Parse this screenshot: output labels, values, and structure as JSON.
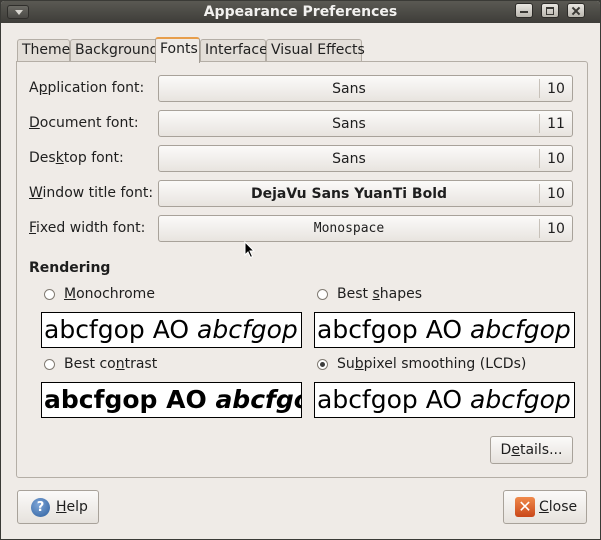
{
  "window": {
    "title": "Appearance Preferences"
  },
  "tabs": [
    {
      "label": "Theme"
    },
    {
      "label": "Background"
    },
    {
      "label": "Fonts"
    },
    {
      "label": "Interface"
    },
    {
      "label": "Visual Effects"
    }
  ],
  "fonts": [
    {
      "pre": "A",
      "key": "p",
      "post": "plication font:",
      "value": "Sans",
      "size": "10"
    },
    {
      "pre": "",
      "key": "D",
      "post": "ocument font:",
      "value": "Sans",
      "size": "11"
    },
    {
      "pre": "Des",
      "key": "k",
      "post": "top font:",
      "value": "Sans",
      "size": "10"
    },
    {
      "pre": "",
      "key": "W",
      "post": "indow title font:",
      "value": "DejaVu Sans YuanTi Bold",
      "size": "10"
    },
    {
      "pre": "",
      "key": "F",
      "post": "ixed width font:",
      "value": "Monospace",
      "size": "10"
    }
  ],
  "rendering": {
    "title": "Rendering",
    "options": [
      {
        "pre": "",
        "key": "M",
        "post": "onochrome",
        "checked": false
      },
      {
        "pre": "Best ",
        "key": "s",
        "post": "hapes",
        "checked": false
      },
      {
        "pre": "Best co",
        "key": "n",
        "post": "trast",
        "checked": false
      },
      {
        "pre": "Su",
        "key": "b",
        "post": "pixel smoothing (LCDs)",
        "checked": true
      }
    ],
    "sample_regular": "abcfgop AO ",
    "sample_italic": "abcfgop"
  },
  "buttons": {
    "details_pre": "D",
    "details_key": "e",
    "details_post": "tails...",
    "help_key": "H",
    "help_post": "elp",
    "close_key": "C",
    "close_post": "lose"
  },
  "icons": {
    "help": "?",
    "close": "✕"
  }
}
